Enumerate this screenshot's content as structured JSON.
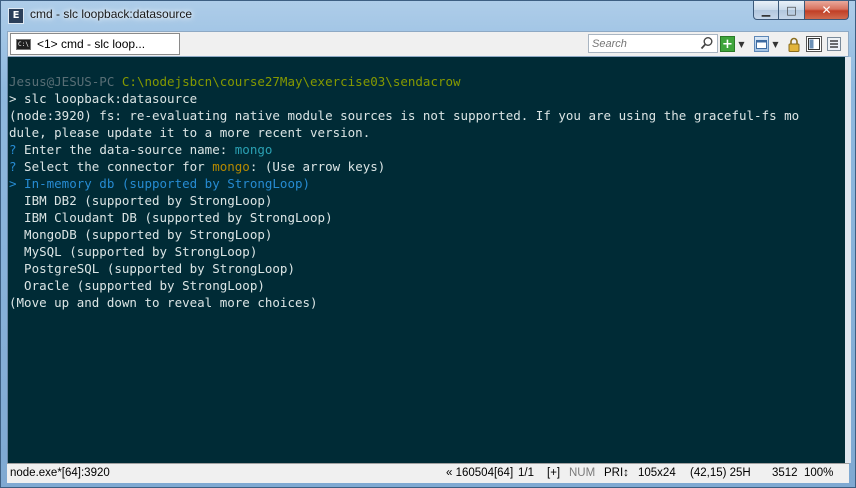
{
  "window": {
    "title": "cmd - slc  loopback:datasource",
    "icon": "console-app-icon",
    "minimize_label": "▁",
    "maximize_label": "□",
    "close_label": "✕"
  },
  "tabs": [
    {
      "label": "<1> cmd - slc  loop..."
    }
  ],
  "search": {
    "placeholder": "Search"
  },
  "console": {
    "prompt_user": "Jesus@JESUS-PC",
    "prompt_path": "C:\\nodejsbcn\\course27May\\exercise03\\sendacrow",
    "command": "> slc loopback:datasource",
    "warn1": "(node:3920) fs: re-evaluating native module sources is not supported. If you are using the graceful-fs mo",
    "warn2": "dule, please update it to a more recent version.",
    "q1_mark": "?",
    "q1_text": " Enter the data-source name: ",
    "q1_value": "mongo",
    "q2_mark": "?",
    "q2_text_a": " Select the connector for ",
    "q2_value": "mongo",
    "q2_text_b": ": (Use arrow keys)",
    "selected_option": "> In-memory db (supported by StrongLoop)",
    "options": [
      "  IBM DB2 (supported by StrongLoop)",
      "  IBM Cloudant DB (supported by StrongLoop)",
      "  MongoDB (supported by StrongLoop)",
      "  MySQL (supported by StrongLoop)",
      "  PostgreSQL (supported by StrongLoop)",
      "  Oracle (supported by StrongLoop)"
    ],
    "hint": "(Move up and down to reveal more choices)"
  },
  "statusbar": {
    "process": "node.exe*[64]:3920",
    "selection": "« 160504[64]",
    "position": "1/1",
    "insert": "[+]",
    "num": "NUM",
    "priority": "PRI↕",
    "size": "105x24",
    "cursor": "(42,15) 25H",
    "pid": "3512",
    "zoom": "100%"
  },
  "colors": {
    "console_bg": "#002b36",
    "console_fg": "#dbe5e5",
    "path": "#859900",
    "question": "#268bd2",
    "value": "#2aa1b3",
    "highlight": "#b58900"
  }
}
